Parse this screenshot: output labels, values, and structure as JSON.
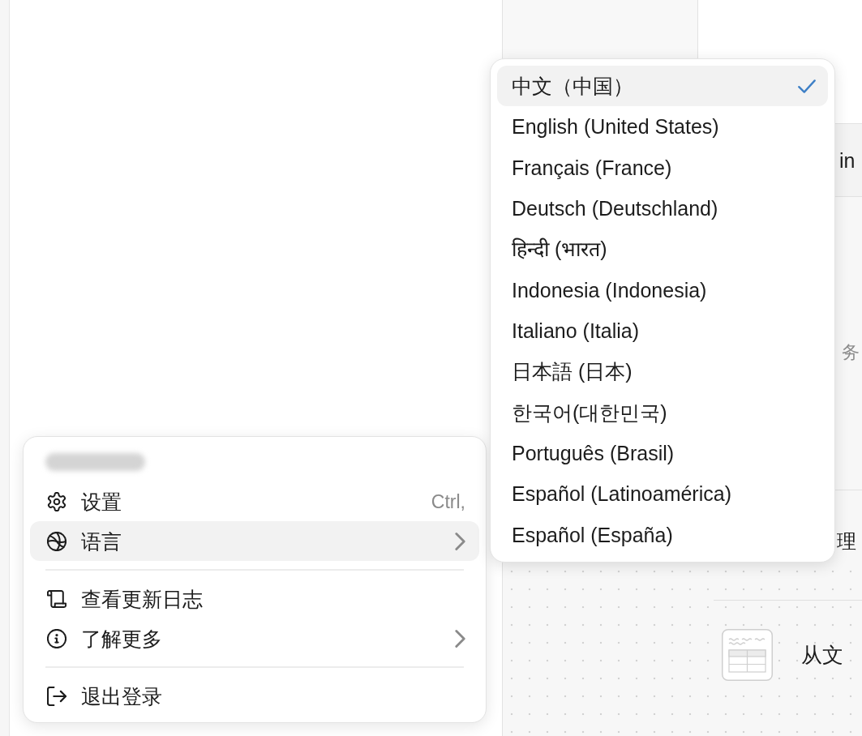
{
  "right_panel": {
    "card_text": "in",
    "texts": [
      "务",
      "理",
      "从文"
    ]
  },
  "user_menu": {
    "items": [
      {
        "kind": "item",
        "label": "设置",
        "shortcut": "Ctrl,",
        "has_submenu": false,
        "highlighted": false
      },
      {
        "kind": "item",
        "label": "语言",
        "has_submenu": true,
        "highlighted": true
      },
      {
        "kind": "separator"
      },
      {
        "kind": "item",
        "label": "查看更新日志",
        "has_submenu": false,
        "highlighted": false
      },
      {
        "kind": "item",
        "label": "了解更多",
        "has_submenu": true,
        "highlighted": false
      },
      {
        "kind": "separator"
      },
      {
        "kind": "item",
        "label": "退出登录",
        "has_submenu": false,
        "highlighted": false
      }
    ]
  },
  "language_menu": {
    "items": [
      {
        "label": "中文（中国）",
        "selected": true,
        "highlighted": true
      },
      {
        "label": "English (United States)",
        "selected": false,
        "highlighted": false
      },
      {
        "label": "Français (France)",
        "selected": false,
        "highlighted": false
      },
      {
        "label": "Deutsch (Deutschland)",
        "selected": false,
        "highlighted": false
      },
      {
        "label": "हिन्दी (भारत)",
        "selected": false,
        "highlighted": false
      },
      {
        "label": "Indonesia (Indonesia)",
        "selected": false,
        "highlighted": false
      },
      {
        "label": "Italiano (Italia)",
        "selected": false,
        "highlighted": false
      },
      {
        "label": "日本語 (日本)",
        "selected": false,
        "highlighted": false
      },
      {
        "label": "한국어(대한민국)",
        "selected": false,
        "highlighted": false
      },
      {
        "label": "Português (Brasil)",
        "selected": false,
        "highlighted": false
      },
      {
        "label": "Español (Latinoamérica)",
        "selected": false,
        "highlighted": false
      },
      {
        "label": "Español (España)",
        "selected": false,
        "highlighted": false
      }
    ]
  }
}
